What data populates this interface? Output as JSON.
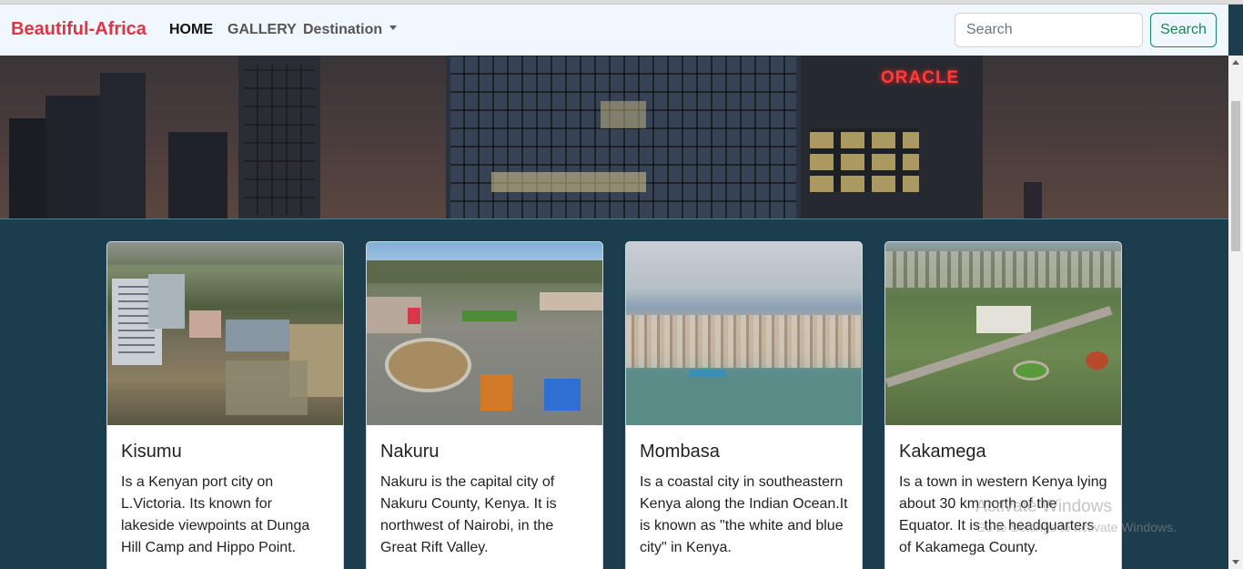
{
  "navbar": {
    "brand": "Beautiful-Africa",
    "links": [
      {
        "label": "HOME"
      },
      {
        "label": "GALLERY"
      },
      {
        "label": "Destination"
      }
    ],
    "search": {
      "placeholder": "Search",
      "button_label": "Search"
    },
    "colors": {
      "brand": "#dc3545",
      "search_button": "#198754",
      "background": "#f1f8fd"
    }
  },
  "hero": {
    "sign_text": "ORACLE"
  },
  "cards": [
    {
      "title": "Kisumu",
      "text": "Is a Kenyan port city on L.Victoria. Its known for lakeside viewpoints at Dunga Hill Camp and Hippo Point."
    },
    {
      "title": "Nakuru",
      "text": "Nakuru is the capital city of Nakuru County, Kenya. It is northwest of Nairobi, in the Great Rift Valley."
    },
    {
      "title": "Mombasa",
      "text": "Is a coastal city in southeastern Kenya along the Indian Ocean.It is known as \"the white and blue city\" in Kenya."
    },
    {
      "title": "Kakamega",
      "text": "Is a town in western Kenya lying about 30 km north of the Equator. It is the headquarters of Kakamega County."
    }
  ],
  "watermark": {
    "line1": "Activate Windows",
    "line2": "Go to Settings to activate Windows."
  },
  "page_background": "#1b3d4d"
}
